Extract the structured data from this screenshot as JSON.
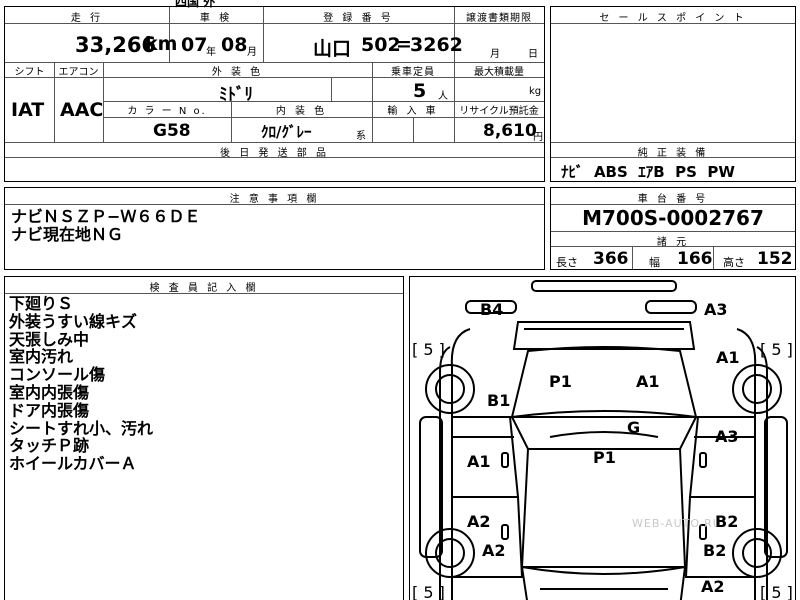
{
  "top_fragment": "四国 外",
  "spec": {
    "mileage_label": "走 行",
    "mileage_value": "33,266",
    "mileage_unit": "km",
    "inspection_label": "車 検",
    "inspection_year": "07",
    "inspection_year_unit": "年",
    "inspection_month": "08",
    "inspection_month_unit": "月",
    "registration_label": "登 録 番 号",
    "registration_area": "山口",
    "registration_number": "502",
    "registration_sep": "=",
    "registration_number2": "3262",
    "transfer_label": "譲渡書類期限",
    "transfer_month_unit": "月",
    "transfer_day_unit": "日",
    "shift_label": "シフト",
    "shift_value": "IAT",
    "aircon_label": "エアコン",
    "aircon_value": "AAC",
    "exterior_color_label": "外 装 色",
    "exterior_color_value": "ﾐﾄﾞﾘ",
    "capacity_label": "乗車定員",
    "capacity_value": "5",
    "capacity_unit": "人",
    "max_load_label": "最大積載量",
    "max_load_unit": "kg",
    "color_no_label": "カ ラ ー N o.",
    "color_no_value": "G58",
    "interior_color_label": "内 装 色",
    "interior_color_value": "ｸﾛ/ｸﾞﾚｰ",
    "interior_suffix": "系",
    "import_label": "輸 入 車",
    "recycle_label": "リサイクル預託金",
    "recycle_value": "8,610",
    "recycle_unit": "円",
    "later_parts_label": "後 日 発 送 部 品"
  },
  "sales_point": {
    "label": "セ ー ル ス ポ イ ン ト"
  },
  "equipment": {
    "label": "純 正 装 備",
    "value": "ﾅﾋﾞ  ABS  ｴｱB  PS  PW"
  },
  "caution": {
    "label": "注 意 事 項 欄",
    "lines": [
      "ナビＮＳＺＰ−Ｗ６６ＤＥ",
      "ナビ現在地ＮＧ"
    ]
  },
  "chassis": {
    "label": "車 台 番 号",
    "value": "M700S-0002767",
    "spec_label": "諸 元",
    "length_label": "長さ",
    "length_value": "366",
    "width_label": "幅",
    "width_value": "166",
    "height_label": "高さ",
    "height_value": "152"
  },
  "inspector": {
    "label": "検 査 員 記 入 欄",
    "lines": [
      "下廻りＳ",
      "外装うすい線キズ",
      "天張しみ中",
      "室内汚れ",
      "コンソール傷",
      "室内内張傷",
      "ドア内張傷",
      "シートすれ小、汚れ",
      "タッチＰ跡",
      "ホイールカバーＡ"
    ]
  },
  "diagram": {
    "watermark": "WEB-AUTO.RU",
    "labels": {
      "front_left": "B4",
      "front_right": "A3",
      "tire_fl": "[ 5 ]",
      "tire_fr": "[ 5 ]",
      "tire_rl": "[ 5 ]",
      "tire_rr": "[ 5 ]",
      "fender_r": "A1",
      "hood_left": "P1",
      "hood_right": "A1",
      "fender_l": "B1",
      "roof": "G",
      "cabin": "P1",
      "door_r": "A3",
      "door_l_front": "A1",
      "door_l_rear": "A2",
      "door_r_rear": "B2",
      "quarter_l": "A2",
      "quarter_r": "B2",
      "rear_r": "A2"
    }
  }
}
